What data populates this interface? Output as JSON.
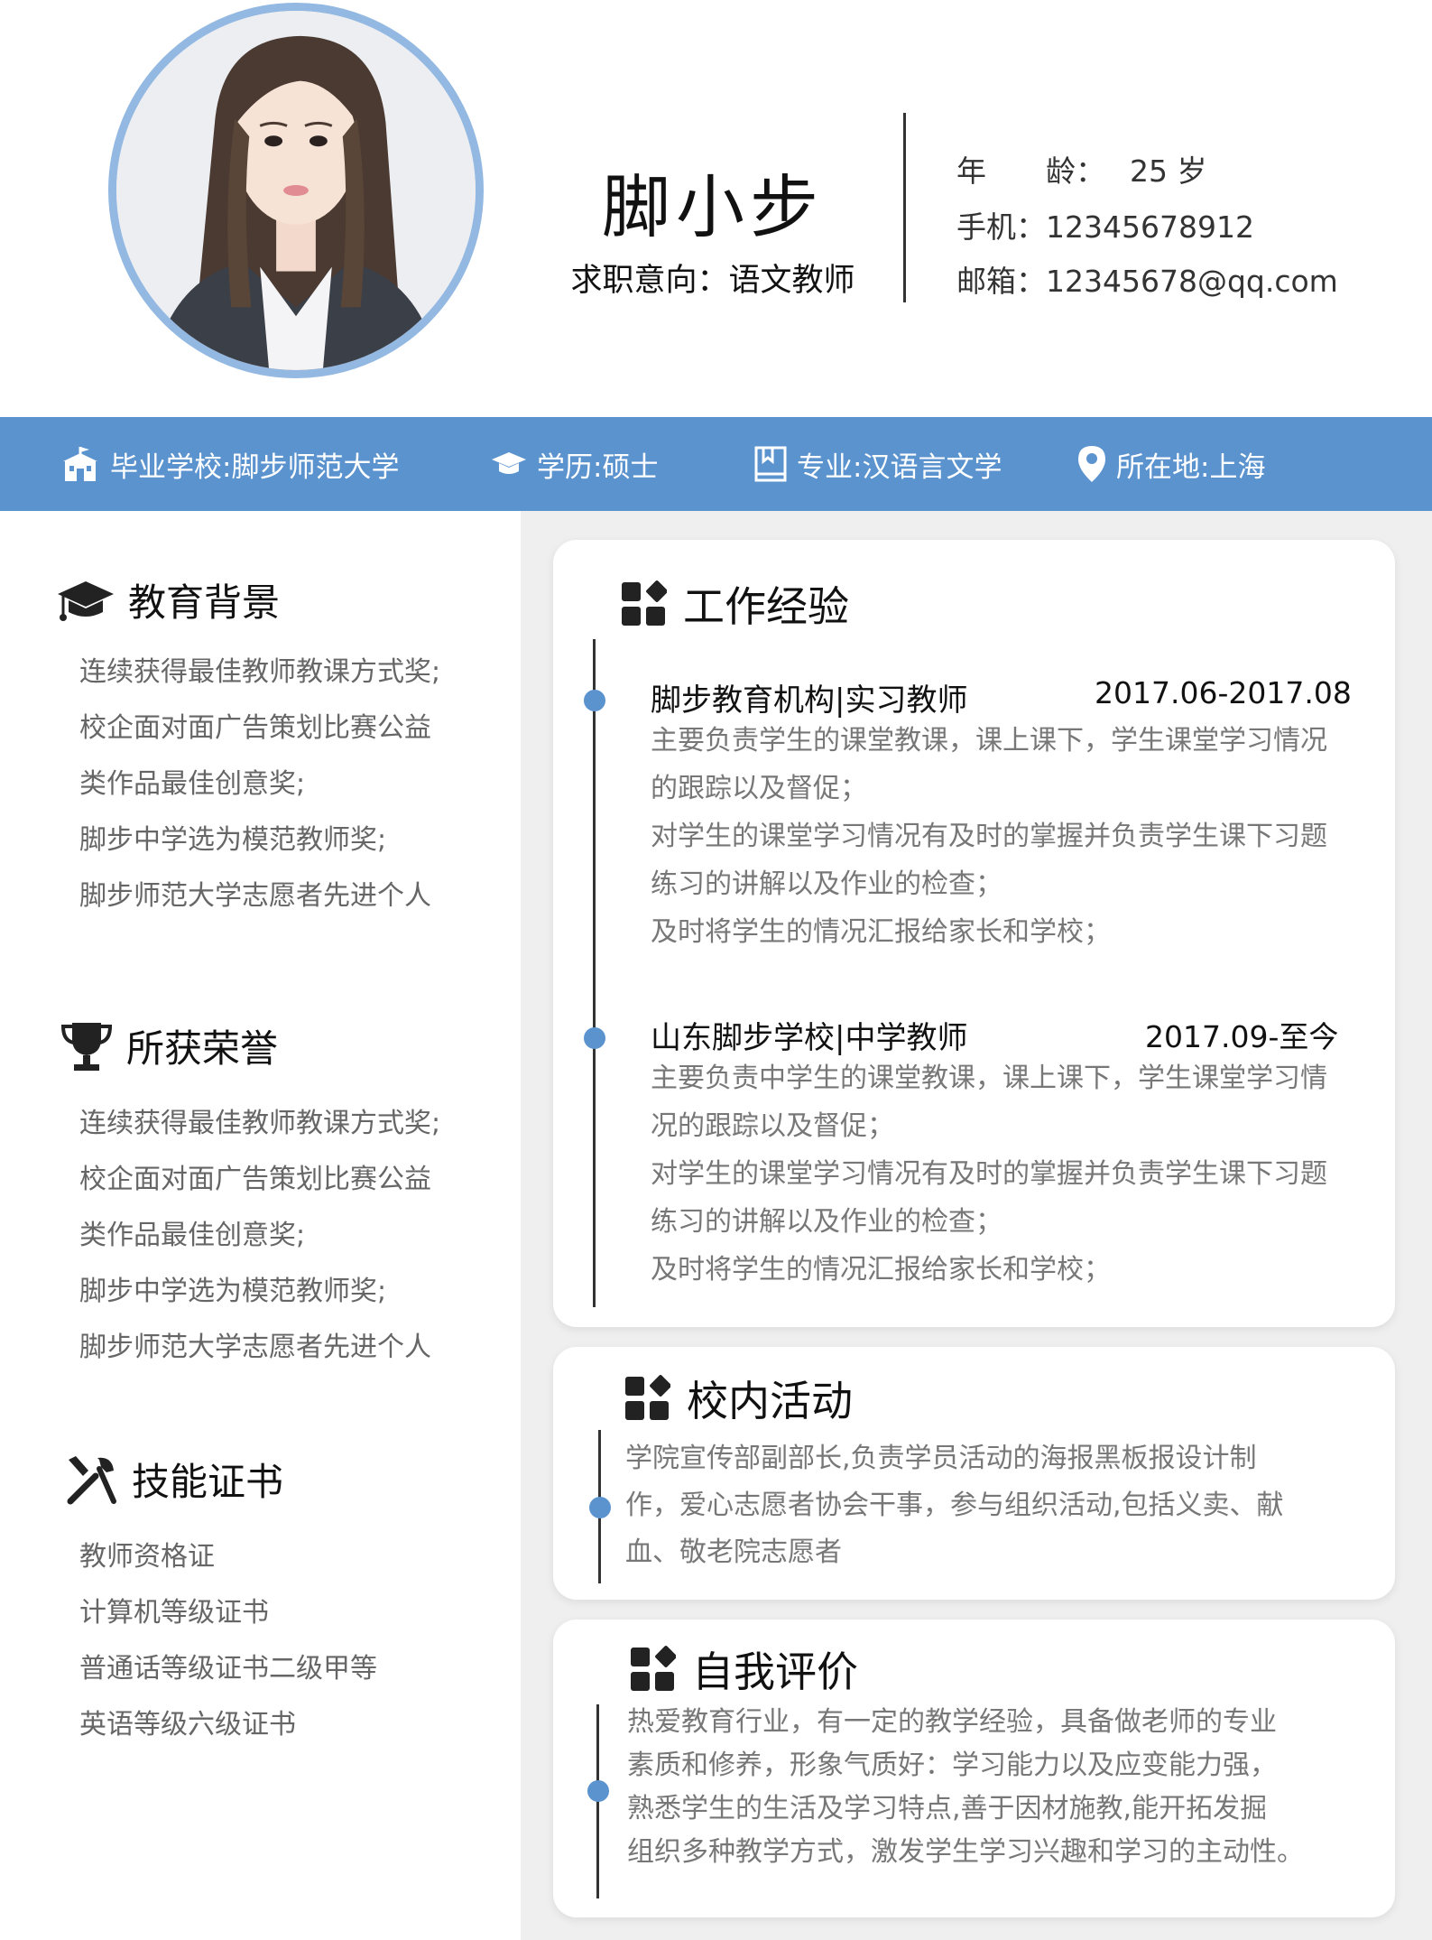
{
  "header": {
    "name": "脚小步",
    "intent": "求职意向：语文教师",
    "age_label": "年　　龄：",
    "age_value": "25 岁",
    "phone_label": "手机：",
    "phone_value": "12345678912",
    "email_label": "邮箱：",
    "email_value": "12345678@qq.com"
  },
  "band": {
    "school": "毕业学校:脚步师范大学",
    "degree": "学历:硕士",
    "major": "专业:汉语言文学",
    "location": "所在地:上海"
  },
  "education": {
    "title": "教育背景",
    "items": [
      "连续获得最佳教师教课方式奖;",
      "校企面对面广告策划比赛公益",
      "类作品最佳创意奖;",
      "脚步中学选为模范教师奖;",
      "脚步师范大学志愿者先进个人"
    ]
  },
  "honors": {
    "title": "所获荣誉",
    "items": [
      "连续获得最佳教师教课方式奖;",
      "校企面对面广告策划比赛公益",
      "类作品最佳创意奖;",
      "脚步中学选为模范教师奖;",
      "脚步师范大学志愿者先进个人"
    ]
  },
  "skills": {
    "title": "技能证书",
    "items": [
      "教师资格证",
      "计算机等级证书",
      "普通话等级证书二级甲等",
      "英语等级六级证书"
    ]
  },
  "work": {
    "title": "工作经验",
    "jobs": [
      {
        "org": "脚步教育机构|实习教师",
        "date": "2017.06-2017.08",
        "lines": [
          "主要负责学生的课堂教课，课上课下，学生课堂学习情况",
          "的跟踪以及督促；",
          "对学生的课堂学习情况有及时的掌握并负责学生课下习题",
          "练习的讲解以及作业的检查；",
          "及时将学生的情况汇报给家长和学校；"
        ]
      },
      {
        "org": "山东脚步学校|中学教师",
        "date": "2017.09-至今",
        "lines": [
          "主要负责中学生的课堂教课，课上课下，学生课堂学习情",
          "况的跟踪以及督促；",
          "对学生的课堂学习情况有及时的掌握并负责学生课下习题",
          "练习的讲解以及作业的检查；",
          "及时将学生的情况汇报给家长和学校；"
        ]
      }
    ]
  },
  "activities": {
    "title": "校内活动",
    "lines": [
      "学院宣传部副部长,负责学员活动的海报黑板报设计制",
      "作，爱心志愿者协会干事，参与组织活动,包括义卖、献",
      "血、敬老院志愿者"
    ]
  },
  "self_eval": {
    "title": "自我评价",
    "lines": [
      "热爱教育行业，有一定的教学经验，具备做老师的专业",
      "素质和修养，形象气质好：学习能力以及应变能力强，",
      "熟悉学生的生活及学习特点,善于因材施教,能开拓发掘",
      "组织多种教学方式，激发学生学习兴趣和学习的主动性。"
    ]
  },
  "colors": {
    "accent": "#5b93cf",
    "avatar_ring": "#93b8e2",
    "panel_bg": "#efefef"
  }
}
